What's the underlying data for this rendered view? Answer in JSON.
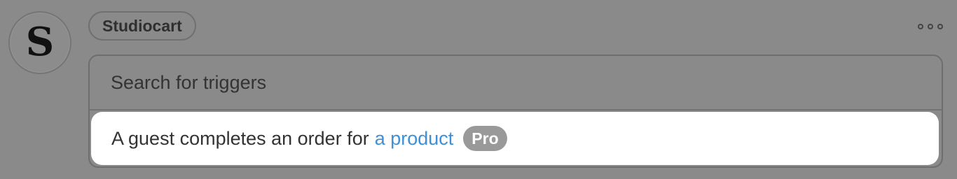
{
  "app": {
    "avatar_letter": "S",
    "name": "Studiocart"
  },
  "header": {
    "more_icon": "more-dots-icon"
  },
  "search": {
    "placeholder": "Search for triggers",
    "value": ""
  },
  "results": [
    {
      "text": "A guest completes an order for",
      "link_text": "a product",
      "badge": "Pro"
    }
  ],
  "colors": {
    "overlay_background": "#8a8a8a",
    "link": "#3f8fd8",
    "badge_background": "#999999",
    "option_background": "#ffffff"
  }
}
